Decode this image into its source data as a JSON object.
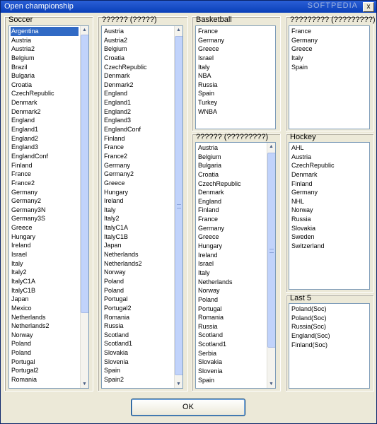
{
  "window": {
    "title": "Open championship",
    "watermark": "SOFTPEDIA",
    "close_glyph": "x"
  },
  "soccer": {
    "label": "Soccer",
    "selected": "Argentina",
    "items": [
      "Argentina",
      "Austria",
      "Austria2",
      "Belgium",
      "Brazil",
      "Bulgaria",
      "Croatia",
      "CzechRepublic",
      "Denmark",
      "Denmark2",
      "England",
      "England1",
      "England2",
      "England3",
      "EnglandConf",
      "Finland",
      "France",
      "France2",
      "Germany",
      "Germany2",
      "Germany3N",
      "Germany3S",
      "Greece",
      "Hungary",
      "Ireland",
      "Israel",
      "Italy",
      "Italy2",
      "ItalyC1A",
      "ItalyC1B",
      "Japan",
      "Mexico",
      "Netherlands",
      "Netherlands2",
      "Norway",
      "Poland",
      "Poland",
      "Portugal",
      "Portugal2",
      "Romania"
    ]
  },
  "col2": {
    "label": "?????? (?????)",
    "items": [
      "Austria",
      "Austria2",
      "Belgium",
      "Croatia",
      "CzechRepublic",
      "Denmark",
      "Denmark2",
      "England",
      "England1",
      "England2",
      "England3",
      "EnglandConf",
      "Finland",
      "France",
      "France2",
      "Germany",
      "Germany2",
      "Greece",
      "Hungary",
      "Ireland",
      "Italy",
      "Italy2",
      "ItalyC1A",
      "ItalyC1B",
      "Japan",
      "Netherlands",
      "Netherlands2",
      "Norway",
      "Poland",
      "Poland",
      "Portugal",
      "Portugal2",
      "Romania",
      "Russia",
      "Scotland",
      "Scotland1",
      "Slovakia",
      "Slovenia",
      "Spain",
      "Spain2"
    ]
  },
  "basketball": {
    "label": "Basketball",
    "items": [
      "France",
      "Germany",
      "Greece",
      "Israel",
      "Italy",
      "NBA",
      "Russia",
      "Spain",
      "Turkey",
      "WNBA"
    ]
  },
  "col4": {
    "label": "????????? (?????????)",
    "items": [
      "France",
      "Germany",
      "Greece",
      "Italy",
      "Spain"
    ]
  },
  "col5": {
    "label": "?????? (?????????)",
    "items": [
      "Austria",
      "Belgium",
      "Bulgaria",
      "Croatia",
      "CzechRepublic",
      "Denmark",
      "England",
      "Finland",
      "France",
      "Germany",
      "Greece",
      "Hungary",
      "Ireland",
      "Israel",
      "Italy",
      "Netherlands",
      "Norway",
      "Poland",
      "Portugal",
      "Romania",
      "Russia",
      "Scotland",
      "Scotland1",
      "Serbia",
      "Slovakia",
      "Slovenia",
      "Spain"
    ]
  },
  "hockey": {
    "label": "Hockey",
    "items": [
      "AHL",
      "Austria",
      "CzechRepublic",
      "Denmark",
      "Finland",
      "Germany",
      "NHL",
      "Norway",
      "Russia",
      "Slovakia",
      "Sweden",
      "Switzerland"
    ]
  },
  "last5": {
    "label": "Last 5",
    "items": [
      "Poland(Soc)",
      "Poland(Soc)",
      "Russia(Soc)",
      "England(Soc)",
      "Finland(Soc)"
    ]
  },
  "ok_label": "OK",
  "scroll": {
    "up_glyph": "▲",
    "down_glyph": "▼"
  }
}
